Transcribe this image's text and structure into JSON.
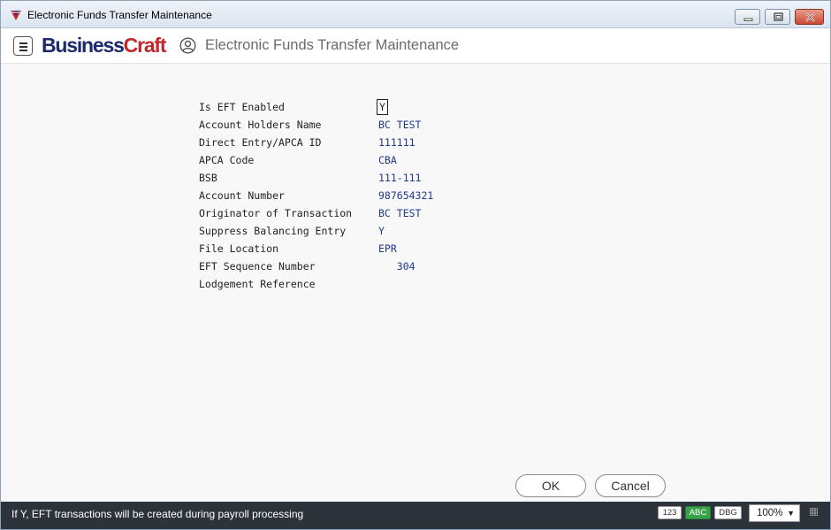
{
  "window": {
    "title": "Electronic Funds Transfer Maintenance"
  },
  "header": {
    "logo_part1": "Business",
    "logo_part2": "Craft",
    "page_title": "Electronic Funds Transfer Maintenance"
  },
  "form": {
    "fields": [
      {
        "label": "Is EFT Enabled",
        "value": "Y"
      },
      {
        "label": "Account Holders Name",
        "value": "BC TEST"
      },
      {
        "label": "Direct Entry/APCA ID",
        "value": "111111"
      },
      {
        "label": "APCA Code",
        "value": "CBA"
      },
      {
        "label": "BSB",
        "value": "111-111"
      },
      {
        "label": "Account Number",
        "value": "987654321"
      },
      {
        "label": "Originator of Transaction",
        "value": "BC TEST"
      },
      {
        "label": "Suppress Balancing Entry",
        "value": "Y"
      },
      {
        "label": "File Location",
        "value": "EPR"
      },
      {
        "label": "EFT Sequence Number",
        "value": "   304"
      },
      {
        "label": "Lodgement Reference",
        "value": ""
      }
    ]
  },
  "buttons": {
    "ok": "OK",
    "cancel": "Cancel"
  },
  "statusbar": {
    "message": "If Y, EFT transactions will be created during payroll processing",
    "chip_num": "123",
    "chip_abc": "ABC",
    "chip_dbg": "DBG",
    "zoom": "100%"
  },
  "colors": {
    "brand_dark": "#1b2a6b",
    "brand_red": "#c0282e",
    "value_text": "#1f3a8a",
    "statusbar_bg": "#2d333b",
    "abc_active": "#3aa34a"
  },
  "icons": {
    "app": "businesscraft-app-icon",
    "menu": "hamburger-menu-icon",
    "user": "user-profile-icon",
    "minimize": "minimize-icon",
    "maximize": "maximize-icon",
    "close": "close-icon",
    "grid": "grid-icon"
  }
}
